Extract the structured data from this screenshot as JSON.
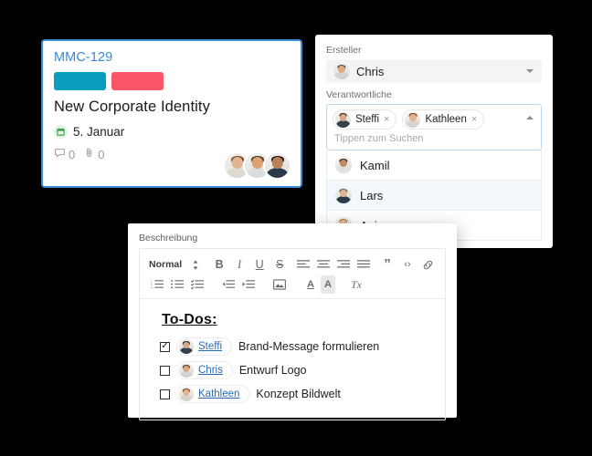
{
  "card": {
    "ticket_id": "MMC-129",
    "labels": [
      {
        "name": "label-teal",
        "color": "#0b9dbd"
      },
      {
        "name": "label-red",
        "color": "#fb5568"
      }
    ],
    "title": "New Corporate Identity",
    "due_date": "5. Januar",
    "calendar_icon": "calendar-icon",
    "comment_icon": "comment-icon",
    "comment_count": "0",
    "attachment_icon": "attachment-icon",
    "attachment_count": "0",
    "avatars": [
      "avatar-female-1",
      "avatar-male-1",
      "avatar-male-2"
    ],
    "border_color": "#3c8dd4",
    "ticket_color": "#3b87d6"
  },
  "right_panel": {
    "creator_label": "Ersteller",
    "creator_value": "Chris",
    "creator_caret_icon": "chevron-down-icon",
    "assignees_label": "Verantwortliche",
    "assignees_caret_icon": "chevron-up-icon",
    "assignee_tags": [
      {
        "name": "Steffi",
        "remove_icon": "close-icon",
        "remove_label": "×"
      },
      {
        "name": "Kathleen",
        "remove_icon": "close-icon",
        "remove_label": "×"
      }
    ],
    "search_placeholder": "Tippen zum Suchen",
    "options": [
      {
        "name": "Kamil",
        "highlighted": false
      },
      {
        "name": "Lars",
        "highlighted": true
      },
      {
        "name": "Anja",
        "highlighted": false
      }
    ],
    "highlight_color": "#f2f8fc",
    "focus_border_color": "#bcd9f0"
  },
  "editor": {
    "description_label": "Beschreibung",
    "toolbar_row1": [
      {
        "name": "format-style-select",
        "label": "Normal"
      },
      {
        "name": "format-style-stepper-icon",
        "label": "↕"
      },
      {
        "name": "bold-icon",
        "label": "B"
      },
      {
        "name": "italic-icon",
        "label": "I"
      },
      {
        "name": "underline-icon",
        "label": "U"
      },
      {
        "name": "strikethrough-icon",
        "label": "S"
      },
      {
        "name": "align-left-icon",
        "label": "≡"
      },
      {
        "name": "align-center-icon",
        "label": "≡"
      },
      {
        "name": "align-right-icon",
        "label": "≡"
      },
      {
        "name": "align-justify-icon",
        "label": "≡"
      },
      {
        "name": "blockquote-icon",
        "label": "”"
      },
      {
        "name": "code-block-icon",
        "label": "‹›"
      },
      {
        "name": "link-icon",
        "label": "🔗"
      }
    ],
    "toolbar_row2": [
      {
        "name": "ordered-list-icon",
        "label": "≡"
      },
      {
        "name": "bullet-list-icon",
        "label": "≡"
      },
      {
        "name": "checklist-icon",
        "label": "≡"
      },
      {
        "name": "outdent-icon",
        "label": "←"
      },
      {
        "name": "indent-icon",
        "label": "→"
      },
      {
        "name": "insert-image-icon",
        "label": "▣"
      },
      {
        "name": "text-color-icon",
        "label": "A"
      },
      {
        "name": "highlight-color-icon",
        "label": "A"
      },
      {
        "name": "clear-format-icon",
        "label": "Tx"
      }
    ],
    "heading": "To-Dos:",
    "todos": [
      {
        "checked": true,
        "check_glyph": "✓",
        "mention": "Steffi",
        "text": "Brand-Message formulieren"
      },
      {
        "checked": false,
        "check_glyph": "",
        "mention": "Chris",
        "text": "Entwurf Logo"
      },
      {
        "checked": false,
        "check_glyph": "",
        "mention": "Kathleen",
        "text": "Konzept Bildwelt"
      }
    ],
    "mention_color": "#2b6cb0"
  }
}
